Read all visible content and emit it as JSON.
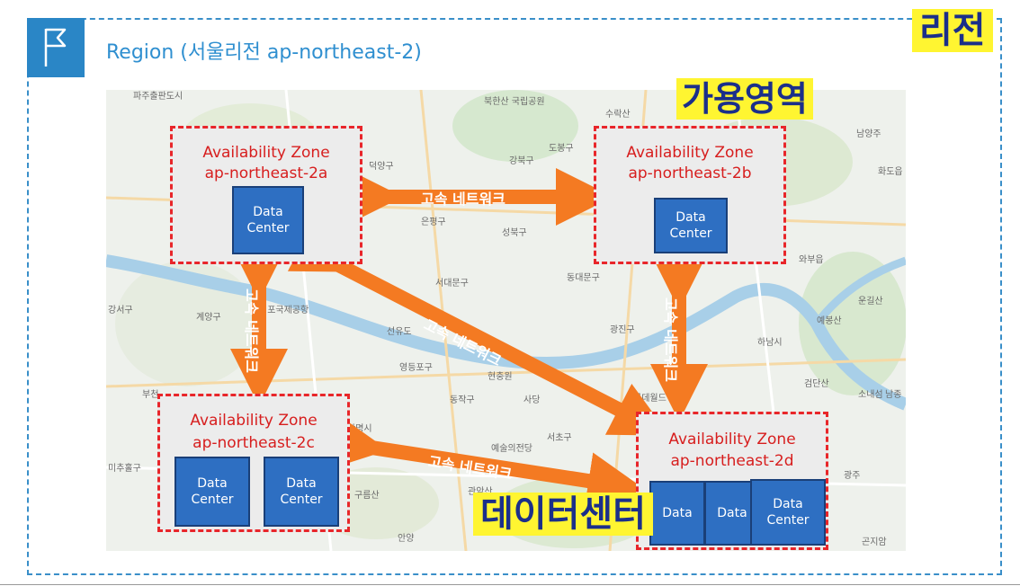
{
  "header": {
    "title": "Region (서울리전 ap-northeast-2)",
    "icon": "flag-icon"
  },
  "callouts": {
    "region": "리전",
    "availability_zone": "가용영역",
    "data_center": "데이터센터"
  },
  "zones": [
    {
      "title": "Availability Zone",
      "id": "ap-northeast-2a",
      "data_centers": [
        "Data Center"
      ]
    },
    {
      "title": "Availability Zone",
      "id": "ap-northeast-2b",
      "data_centers": [
        "Data Center"
      ]
    },
    {
      "title": "Availability Zone",
      "id": "ap-northeast-2c",
      "data_centers": [
        "Data Center",
        "Data Center"
      ]
    },
    {
      "title": "Availability Zone",
      "id": "ap-northeast-2d",
      "data_centers": [
        "Data",
        "Data",
        "Data Center"
      ]
    }
  ],
  "links": [
    {
      "label": "고속 네트워크"
    },
    {
      "label": "고속 네트워크"
    },
    {
      "label": "고속 네트워크"
    },
    {
      "label": "고속 네트워크"
    },
    {
      "label": "고속 네트워크"
    }
  ],
  "map_labels": {
    "l1": "파주출판도시",
    "l2": "북한산 국립공원",
    "l3": "수락산",
    "l4": "도봉구",
    "l5": "강북구",
    "l6": "덕양구",
    "l7": "은평구",
    "l8": "성북구",
    "l9": "서대문구",
    "l10": "동대문구",
    "l11": "김포국제공항",
    "l12": "계양구",
    "l13": "강서구",
    "l14": "영등포구",
    "l15": "동작구",
    "l16": "광진구",
    "l17": "하남시",
    "l18": "서초구",
    "l19": "예술의전당",
    "l20": "광명시",
    "l21": "구름산",
    "l22": "관악산",
    "l23": "검단산",
    "l24": "소내섬",
    "l25": "남종",
    "l26": "예봉산",
    "l27": "운길산",
    "l28": "와부읍",
    "l29": "남양주",
    "l30": "곤지암",
    "l31": "광주",
    "l32": "롯데월드",
    "l33": "선유도",
    "l34": "사당",
    "l35": "현충원",
    "l36": "안양",
    "l37": "부천",
    "l38": "미추홀구",
    "l39": "화도읍"
  }
}
